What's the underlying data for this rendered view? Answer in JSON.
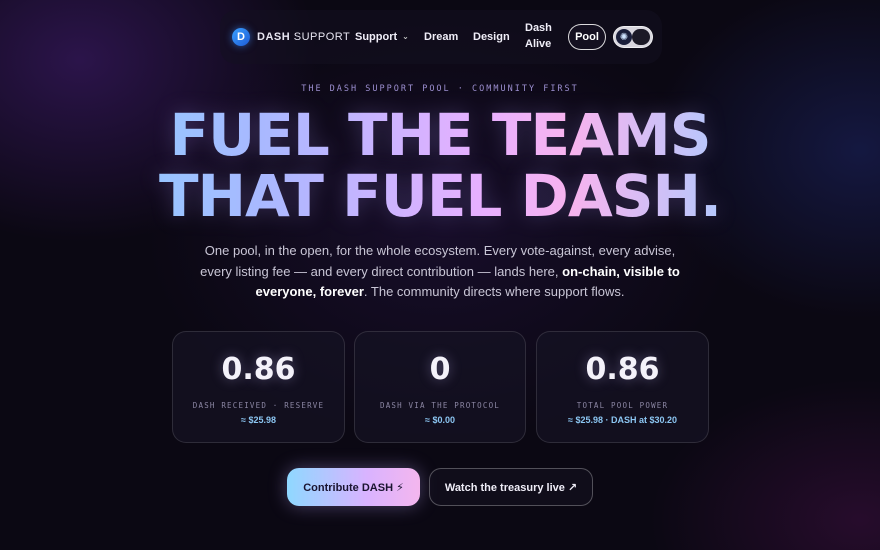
{
  "nav": {
    "brand_bold": "DASH",
    "brand_rest": "SUPPORT",
    "support_label": "Support",
    "dream_label": "Dream",
    "design_label": "Design",
    "dash_alive_line1": "Dash",
    "dash_alive_line2": "Alive",
    "pool_label": "Pool",
    "theme_toggle_icon": "sun-icon"
  },
  "hero": {
    "eyebrow": "THE DASH SUPPORT POOL · COMMUNITY FIRST",
    "headline_line1": "FUEL THE TEAMS",
    "headline_line2": "THAT FUEL DASH.",
    "lead_part1": "One pool, in the open, for the whole ecosystem. Every vote-against, every advise, every listing fee — and every direct contribution — lands here, ",
    "lead_bold": "on-chain, visible to everyone, forever",
    "lead_part2": ". The community directs where support flows."
  },
  "stats": [
    {
      "value": "0.86",
      "label": "DASH RECEIVED · RESERVE",
      "sub": "≈ $25.98"
    },
    {
      "value": "0",
      "label": "DASH VIA THE PROTOCOL",
      "sub": "≈ $0.00"
    },
    {
      "value": "0.86",
      "label": "TOTAL POOL POWER",
      "sub": "≈ $25.98 · DASH at $30.20"
    }
  ],
  "cta": {
    "primary": "Contribute DASH ⚡",
    "secondary": "Watch the treasury live ↗"
  }
}
